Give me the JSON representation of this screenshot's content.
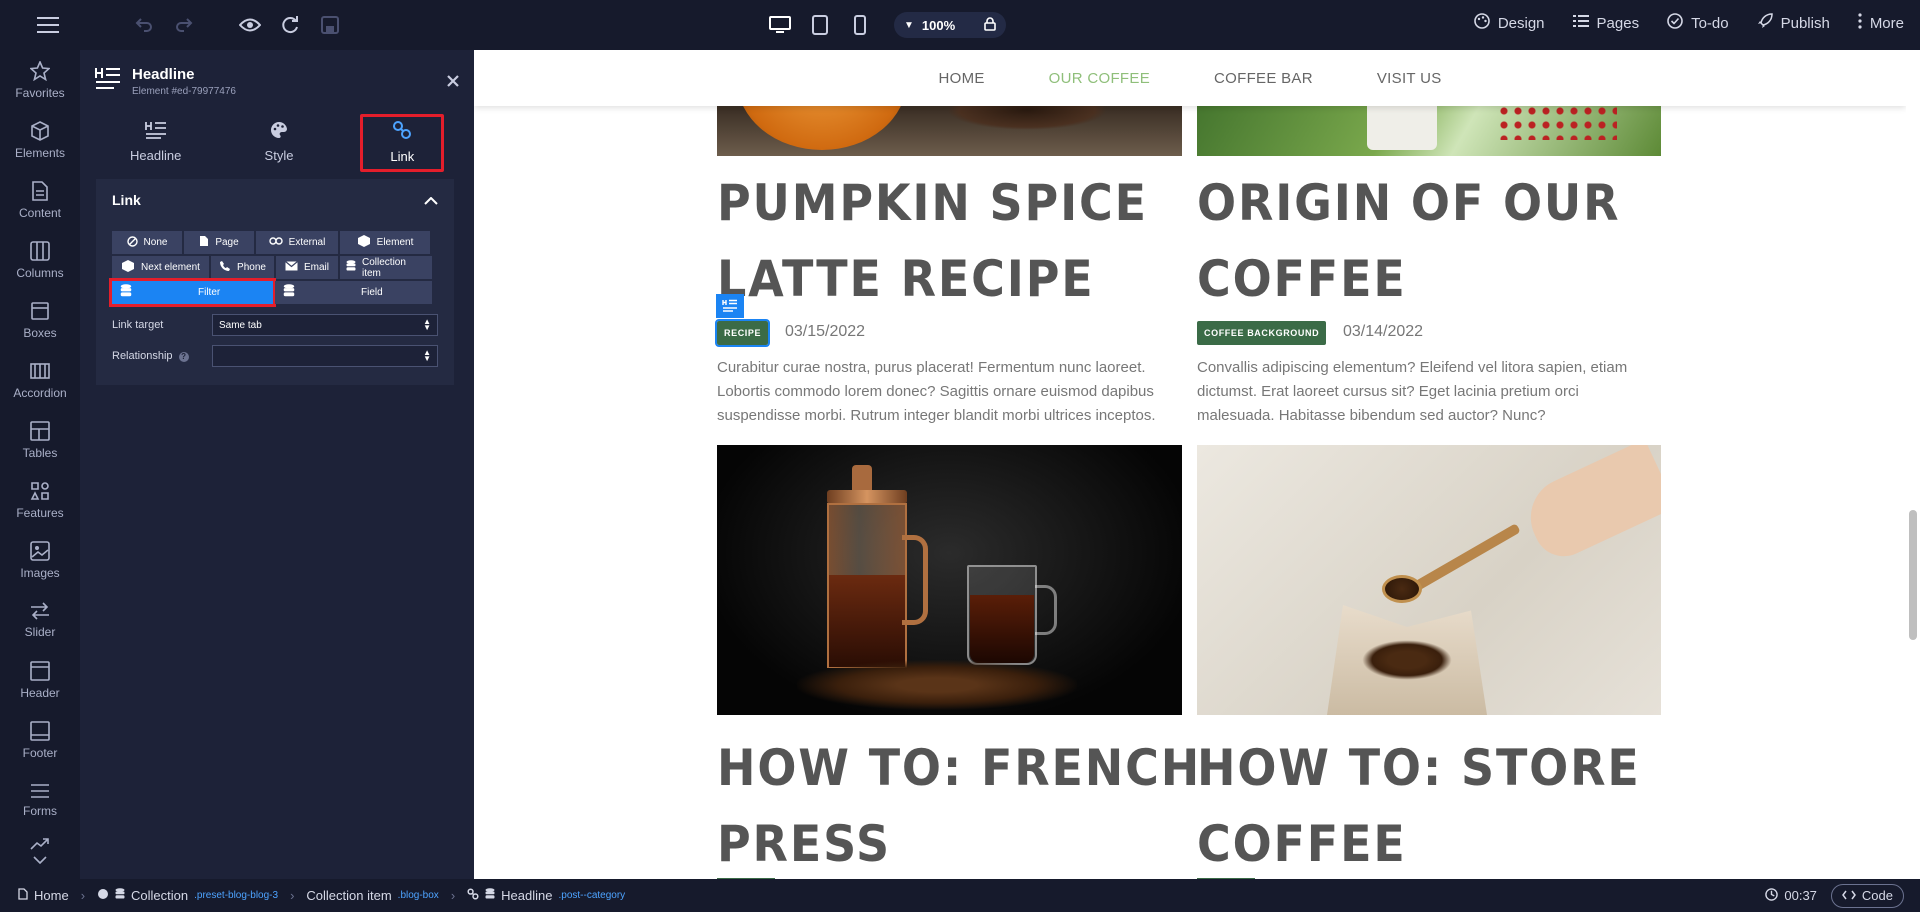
{
  "toolbar": {
    "zoom": "100%",
    "right": [
      {
        "label": "Design",
        "icon": "palette-icon"
      },
      {
        "label": "Pages",
        "icon": "list-icon"
      },
      {
        "label": "To-do",
        "icon": "check-circle-icon"
      },
      {
        "label": "Publish",
        "icon": "rocket-icon"
      },
      {
        "label": "More",
        "icon": "kebab-icon"
      }
    ]
  },
  "sidebar": {
    "items": [
      {
        "label": "Favorites"
      },
      {
        "label": "Elements"
      },
      {
        "label": "Content"
      },
      {
        "label": "Columns"
      },
      {
        "label": "Boxes"
      },
      {
        "label": "Accordion"
      },
      {
        "label": "Tables"
      },
      {
        "label": "Features"
      },
      {
        "label": "Images"
      },
      {
        "label": "Slider"
      },
      {
        "label": "Header"
      },
      {
        "label": "Footer"
      },
      {
        "label": "Forms"
      }
    ]
  },
  "panel": {
    "title": "Headline",
    "subtitle": "Element #ed-79977476",
    "tabs": [
      {
        "label": "Headline"
      },
      {
        "label": "Style"
      },
      {
        "label": "Link"
      }
    ],
    "section_title": "Link",
    "link_types": {
      "none": "None",
      "page": "Page",
      "external": "External",
      "element": "Element",
      "next_element": "Next element",
      "phone": "Phone",
      "email": "Email",
      "collection_item": "Collection item",
      "filter": "Filter",
      "field": "Field"
    },
    "link_target_label": "Link target",
    "link_target_value": "Same tab",
    "relationship_label": "Relationship",
    "relationship_value": ""
  },
  "site": {
    "nav": [
      "HOME",
      "OUR COFFEE",
      "COFFEE BAR",
      "VISIT US"
    ],
    "nav_active": "OUR COFFEE",
    "posts": [
      {
        "title_line1": "PUMPKIN SPICE",
        "title_line2": "LATTE RECIPE",
        "category": "RECIPE",
        "date": "03/15/2022",
        "excerpt": "Curabitur curae nostra, purus placerat! Fermentum nunc laoreet. Lobortis commodo lorem donec? Sagittis ornare euismod dapibus suspendisse morbi. Rutrum integer blandit morbi ultrices inceptos."
      },
      {
        "title_line1": "ORIGIN OF OUR",
        "title_line2": "COFFEE",
        "category": "COFFEE BACKGROUND",
        "date": "03/14/2022",
        "excerpt": "Convallis adipiscing elementum? Eleifend vel litora sapien, etiam dictumst. Erat laoreet cursus sit? Eget lacinia pretium orci malesuada. Habitasse bibendum sed auctor? Nunc?"
      },
      {
        "title_line1": "HOW TO: FRENCH",
        "title_line2": "PRESS"
      },
      {
        "title_line1": "HOW TO: STORE",
        "title_line2": "COFFEE"
      }
    ]
  },
  "statusbar": {
    "crumbs": [
      {
        "label": "Home",
        "cls": ""
      },
      {
        "label": "Collection",
        "cls": ".preset-blog-blog-3"
      },
      {
        "label": "Collection item",
        "cls": ".blog-box"
      },
      {
        "label": "Headline",
        "cls": ".post--category"
      }
    ],
    "time": "00:37",
    "code_label": "Code"
  },
  "colors": {
    "accent": "#1b84f3",
    "highlight": "#e41e2b",
    "badge": "#3b6b47",
    "nav_active": "#8fbf7a"
  }
}
